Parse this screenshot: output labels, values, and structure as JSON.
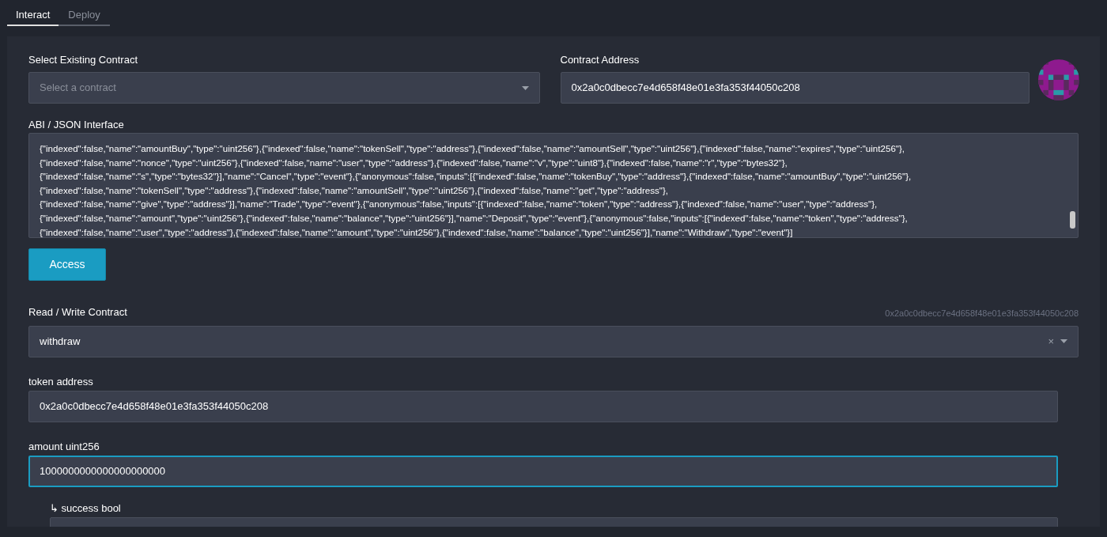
{
  "tabs": [
    {
      "label": "Interact",
      "selected": true
    },
    {
      "label": "Deploy",
      "selected": false
    }
  ],
  "contract_select": {
    "label": "Select Existing Contract",
    "placeholder": "Select a contract"
  },
  "contract_address": {
    "label": "Contract Address",
    "value": "0x2a0c0dbecc7e4d658f48e01e3fa353f44050c208"
  },
  "abi": {
    "label": "ABI / JSON Interface",
    "lines": [
      "{\"indexed\":false,\"name\":\"amountBuy\",\"type\":\"uint256\"},{\"indexed\":false,\"name\":\"tokenSell\",\"type\":\"address\"},{\"indexed\":false,\"name\":\"amountSell\",\"type\":\"uint256\"},{\"indexed\":false,\"name\":\"expires\",\"type\":\"uint256\"},",
      "{\"indexed\":false,\"name\":\"nonce\",\"type\":\"uint256\"},{\"indexed\":false,\"name\":\"user\",\"type\":\"address\"},{\"indexed\":false,\"name\":\"v\",\"type\":\"uint8\"},{\"indexed\":false,\"name\":\"r\",\"type\":\"bytes32\"},",
      "{\"indexed\":false,\"name\":\"s\",\"type\":\"bytes32\"}],\"name\":\"Cancel\",\"type\":\"event\"},{\"anonymous\":false,\"inputs\":[{\"indexed\":false,\"name\":\"tokenBuy\",\"type\":\"address\"},{\"indexed\":false,\"name\":\"amountBuy\",\"type\":\"uint256\"},",
      "{\"indexed\":false,\"name\":\"tokenSell\",\"type\":\"address\"},{\"indexed\":false,\"name\":\"amountSell\",\"type\":\"uint256\"},{\"indexed\":false,\"name\":\"get\",\"type\":\"address\"},",
      "{\"indexed\":false,\"name\":\"give\",\"type\":\"address\"}],\"name\":\"Trade\",\"type\":\"event\"},{\"anonymous\":false,\"inputs\":[{\"indexed\":false,\"name\":\"token\",\"type\":\"address\"},{\"indexed\":false,\"name\":\"user\",\"type\":\"address\"},",
      "{\"indexed\":false,\"name\":\"amount\",\"type\":\"uint256\"},{\"indexed\":false,\"name\":\"balance\",\"type\":\"uint256\"}],\"name\":\"Deposit\",\"type\":\"event\"},{\"anonymous\":false,\"inputs\":[{\"indexed\":false,\"name\":\"token\",\"type\":\"address\"},",
      "{\"indexed\":false,\"name\":\"user\",\"type\":\"address\"},{\"indexed\":false,\"name\":\"amount\",\"type\":\"uint256\"},{\"indexed\":false,\"name\":\"balance\",\"type\":\"uint256\"}],\"name\":\"Withdraw\",\"type\":\"event\"}]"
    ]
  },
  "access_button": "Access",
  "read_write": {
    "label": "Read / Write Contract",
    "address": "0x2a0c0dbecc7e4d658f48e01e3fa353f44050c208",
    "function": "withdraw",
    "clear": "×"
  },
  "inputs": [
    {
      "label": "token address",
      "value": "0x2a0c0dbecc7e4d658f48e01e3fa353f44050c208",
      "focused": false
    },
    {
      "label": "amount uint256",
      "value": "1000000000000000000000",
      "focused": true
    }
  ],
  "outputs": [
    {
      "label": "↳ success bool"
    }
  ]
}
